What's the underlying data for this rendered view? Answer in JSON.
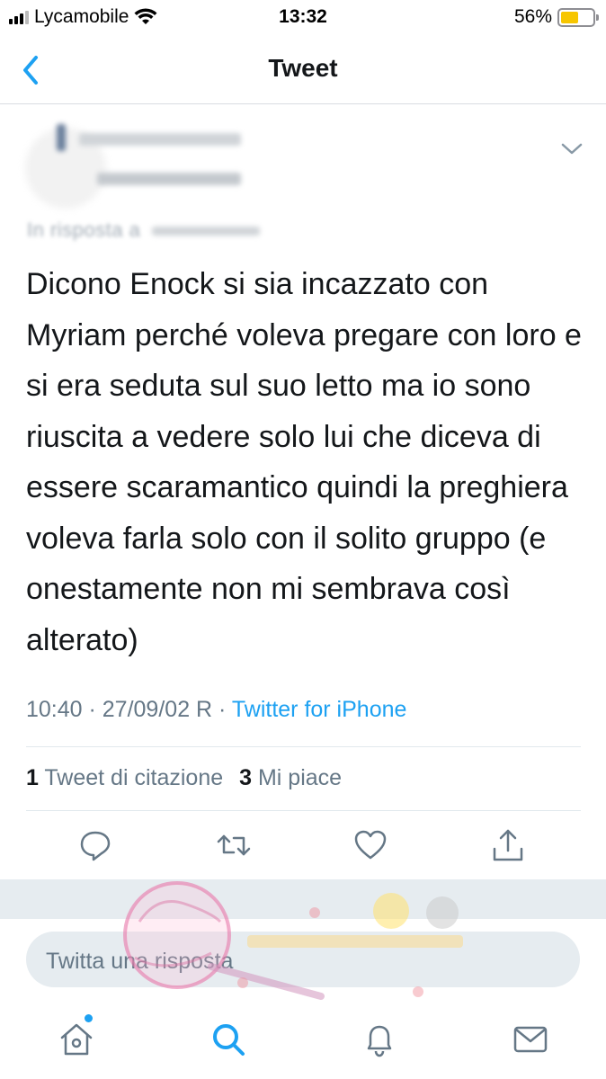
{
  "status_bar": {
    "carrier": "Lycamobile",
    "time": "13:32",
    "battery_percent": "56%",
    "battery_level": 0.56
  },
  "nav": {
    "title": "Tweet",
    "back_icon": "chevron-left-icon"
  },
  "tweet": {
    "reply_prefix": "In risposta a",
    "text": "Dicono Enock si sia incazzato con Myriam perché voleva pregare con loro e si era seduta sul suo letto ma io sono riuscita a vedere solo lui che diceva di essere scaramantico quindi la preghiera voleva farla solo con il solito gruppo (e onestamente non mi sembrava così alterato)",
    "timestamp": "10:40 · 27/09/02 R ·",
    "source": "Twitter for iPhone",
    "quote_count": "1",
    "quote_label": "Tweet di citazione",
    "like_count": "3",
    "like_label": "Mi piace"
  },
  "actions": [
    "reply-icon",
    "retweet-icon",
    "like-icon",
    "share-icon"
  ],
  "compose": {
    "placeholder": "Twitta una risposta"
  },
  "tabbar": [
    "home-icon",
    "search-icon",
    "notifications-icon",
    "messages-icon"
  ],
  "colors": {
    "accent": "#1da1f2",
    "secondary_text": "#657786",
    "battery": "#f7c600"
  }
}
